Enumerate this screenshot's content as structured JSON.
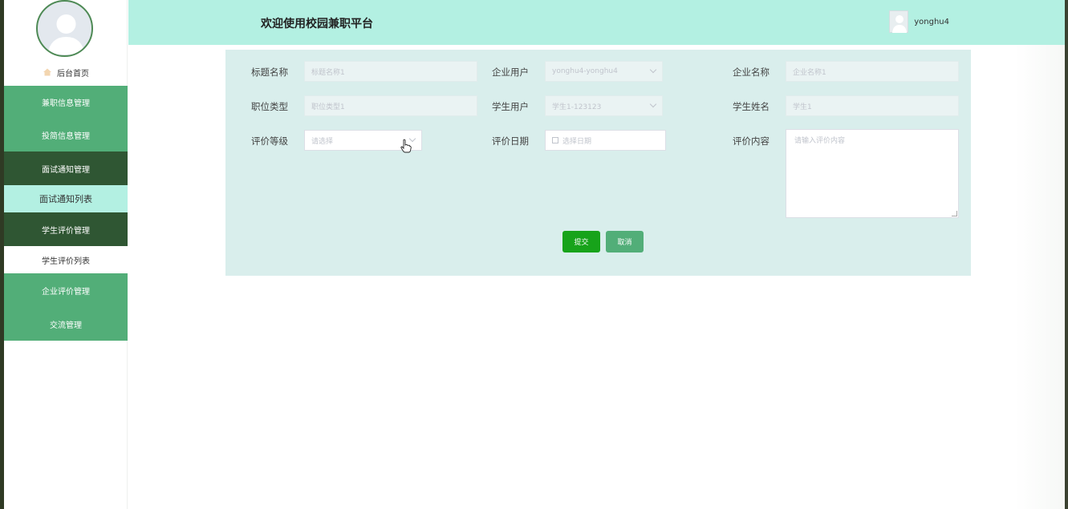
{
  "header": {
    "title": "欢迎使用校园兼职平台",
    "username": "yonghu4"
  },
  "sidebar": {
    "home_label": "后台首页",
    "items": [
      {
        "label": "兼职信息管理"
      },
      {
        "label": "投简信息管理"
      },
      {
        "label": "面试通知管理"
      },
      {
        "label": "面试通知列表"
      },
      {
        "label": "学生评价管理"
      },
      {
        "label": "学生评价列表"
      },
      {
        "label": "企业评价管理"
      },
      {
        "label": "交流管理"
      }
    ]
  },
  "form": {
    "title_label": "标题名称",
    "title_value": "标题名称1",
    "company_user_label": "企业用户",
    "company_user_value": "yonghu4-yonghu4",
    "company_name_label": "企业名称",
    "company_name_value": "企业名称1",
    "position_type_label": "职位类型",
    "position_type_value": "职位类型1",
    "student_user_label": "学生用户",
    "student_user_value": "学生1-123123",
    "student_name_label": "学生姓名",
    "student_name_value": "学生1",
    "rating_label": "评价等级",
    "rating_placeholder": "请选择",
    "date_label": "评价日期",
    "date_placeholder": "选择日期",
    "content_label": "评价内容",
    "content_placeholder": "请输入评价内容",
    "submit_label": "提交",
    "cancel_label": "取消"
  },
  "colors": {
    "header_bg": "#b3f0e2",
    "menu_green": "#52ae78",
    "menu_dark": "#2f5633",
    "submit_green": "#17a31a",
    "card_bg": "#d9eeec"
  }
}
